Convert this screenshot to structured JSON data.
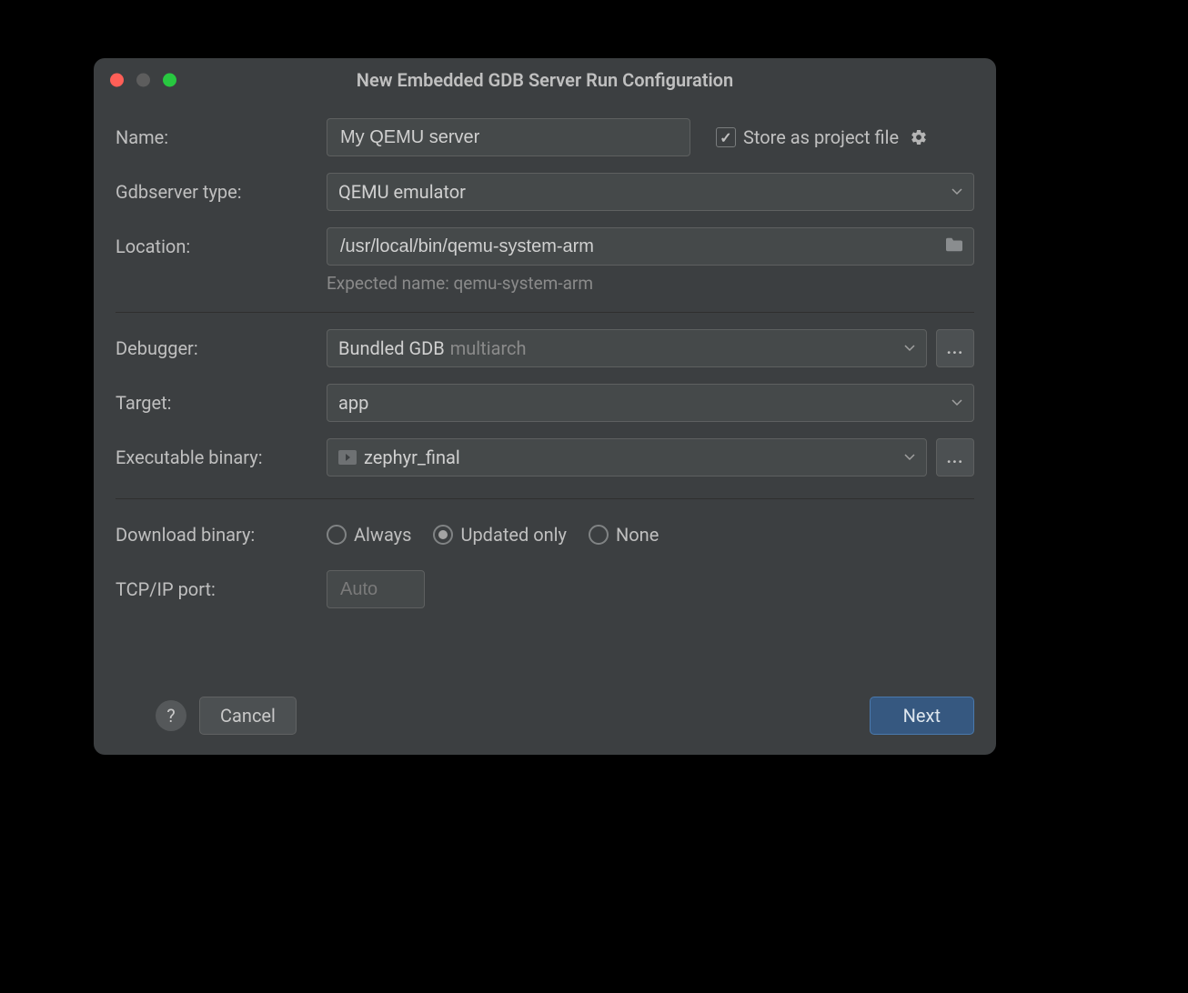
{
  "window_title": "New Embedded GDB Server Run Configuration",
  "labels": {
    "name": "Name:",
    "gdbserver_type": "Gdbserver type:",
    "location": "Location:",
    "debugger": "Debugger:",
    "target": "Target:",
    "executable_binary": "Executable binary:",
    "download_binary": "Download binary:",
    "tcpip_port": "TCP/IP port:",
    "store_as_project_file": "Store as project file"
  },
  "values": {
    "name": "My QEMU server",
    "gdbserver_type": "QEMU emulator",
    "location": "/usr/local/bin/qemu-system-arm",
    "location_hint": "Expected name: qemu-system-arm",
    "debugger_main": "Bundled GDB",
    "debugger_suffix": "multiarch",
    "target": "app",
    "executable_binary": "zephyr_final",
    "tcpip_port_placeholder": "Auto",
    "store_checked": true
  },
  "download_options": {
    "always": "Always",
    "updated_only": "Updated only",
    "none": "None",
    "selected": "updated_only"
  },
  "buttons": {
    "cancel": "Cancel",
    "next": "Next",
    "ellipsis": "..."
  }
}
